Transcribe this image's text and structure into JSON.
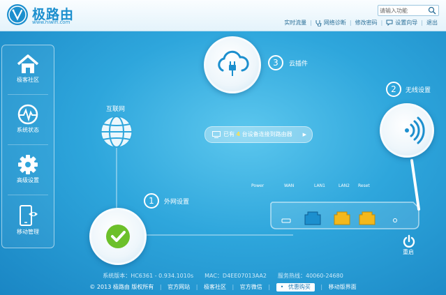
{
  "header": {
    "brand": "极路由",
    "brand_url": "www.hiwifi.com",
    "search_placeholder": "请输入功能",
    "links": [
      "实时流量",
      "网络诊断",
      "修改密码",
      "设置向导",
      "退出"
    ]
  },
  "sidebar": {
    "items": [
      {
        "label": "极客社区",
        "icon": "home-icon"
      },
      {
        "label": "系统状态",
        "icon": "heartbeat-icon"
      },
      {
        "label": "高级设置",
        "icon": "gear-icon"
      },
      {
        "label": "移动管理",
        "icon": "phone-icon"
      }
    ]
  },
  "steps": {
    "cloud": {
      "number": "3",
      "label": "云插件"
    },
    "wireless": {
      "number": "2",
      "label": "无线设置"
    },
    "wan": {
      "number": "1",
      "label": "外网设置"
    }
  },
  "internet_label": "互联网",
  "devices": {
    "prefix": "已有",
    "count": "4",
    "suffix": "台设备连接到路由器"
  },
  "ports": [
    "Power",
    "WAN",
    "LAN1",
    "LAN2",
    "Reset"
  ],
  "reboot_label": "重启",
  "footer": {
    "info": "系统版本：HC6361 - 0.934.1010s　　MAC：D4EE07013AA2　　服务热线：40060-24680",
    "copyright": "© 2013 极路由 版权所有",
    "links": [
      "官方网站",
      "极客社区",
      "官方微信"
    ],
    "deal": "优惠购买",
    "mobile": "移动版界面"
  },
  "colors": {
    "accent": "#1c8fce",
    "check": "#6cc02a",
    "port": "#f3b81c"
  }
}
